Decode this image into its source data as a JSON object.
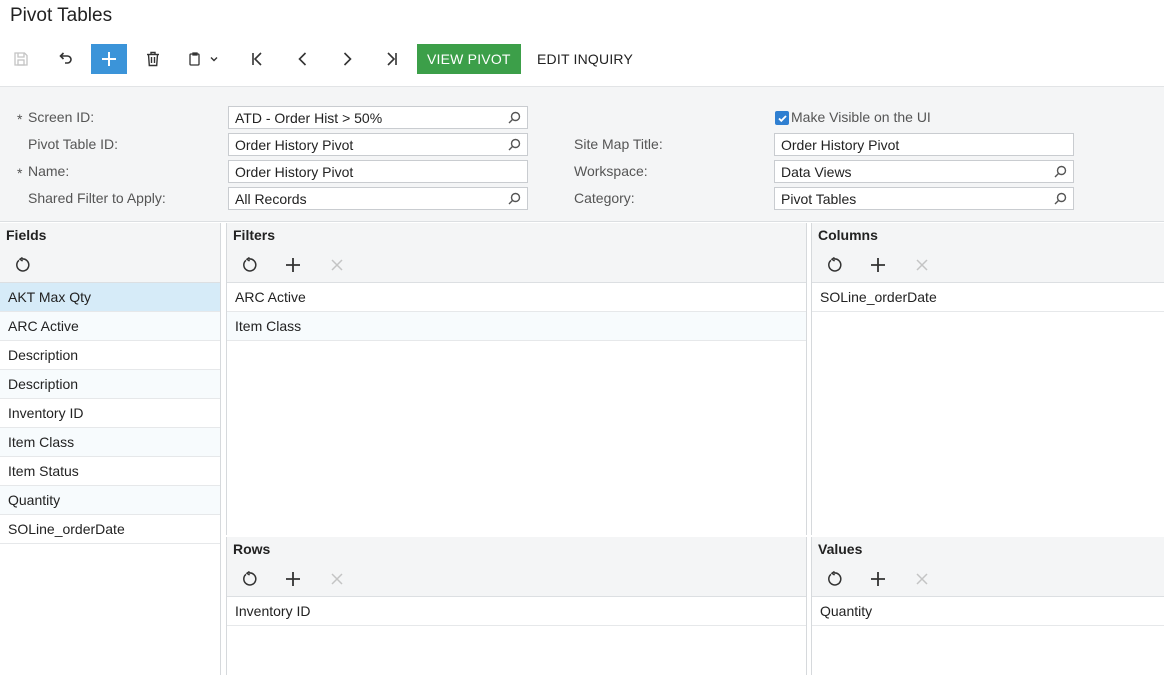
{
  "page": {
    "title": "Pivot Tables"
  },
  "toolbar": {
    "view_pivot_label": "VIEW PIVOT",
    "edit_inquiry_label": "EDIT INQUIRY"
  },
  "form": {
    "screen_id": {
      "label": "Screen ID:",
      "value": "ATD - Order Hist > 50%",
      "required": "*"
    },
    "pivot_table_id": {
      "label": "Pivot Table ID:",
      "value": "Order History Pivot"
    },
    "name": {
      "label": "Name:",
      "value": "Order History Pivot",
      "required": "*"
    },
    "shared_filter": {
      "label": "Shared Filter to Apply:",
      "value": "All Records"
    },
    "make_visible": {
      "label": "Make Visible on the UI",
      "checked": true
    },
    "site_map_title": {
      "label": "Site Map Title:",
      "value": "Order History Pivot"
    },
    "workspace": {
      "label": "Workspace:",
      "value": "Data Views"
    },
    "category": {
      "label": "Category:",
      "value": "Pivot Tables"
    }
  },
  "fields": {
    "title": "Fields",
    "items": [
      "AKT Max Qty",
      "ARC Active",
      "Description",
      "Description",
      "Inventory ID",
      "Item Class",
      "Item Status",
      "Quantity",
      "SOLine_orderDate"
    ]
  },
  "filters": {
    "title": "Filters",
    "items": [
      "ARC Active",
      "Item Class"
    ]
  },
  "columns": {
    "title": "Columns",
    "items": [
      "SOLine_orderDate"
    ]
  },
  "rows": {
    "title": "Rows",
    "items": [
      "Inventory ID"
    ]
  },
  "values": {
    "title": "Values",
    "items": [
      "Quantity"
    ]
  },
  "colors": {
    "primary": "#3b94d9",
    "green": "#3c9f49",
    "selected_row": "#d6ebf8",
    "checkbox": "#2f7fd1"
  }
}
